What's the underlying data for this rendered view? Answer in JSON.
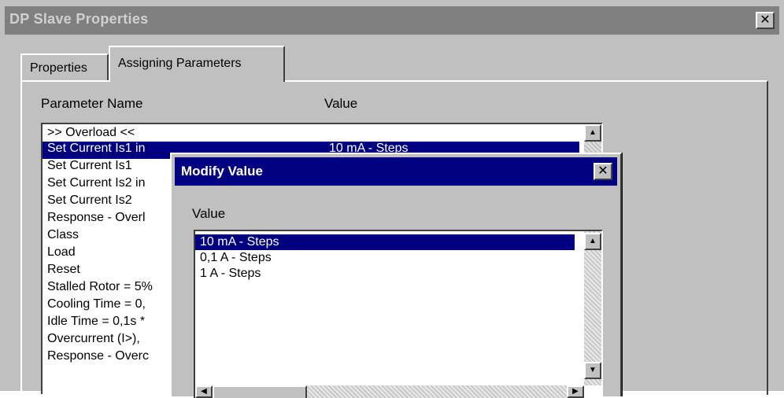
{
  "window": {
    "title": "DP Slave Properties"
  },
  "tabs": [
    {
      "label": "Properties"
    },
    {
      "label": "Assigning Parameters"
    }
  ],
  "columns": {
    "name": "Parameter Name",
    "value": "Value"
  },
  "parameters": [
    {
      "name": ">> Overload <<",
      "value": ""
    },
    {
      "name": "Set Current Is1 in",
      "value": "10 mA - Steps"
    },
    {
      "name": "Set Current Is1",
      "value": ""
    },
    {
      "name": "Set Current Is2 in",
      "value": ""
    },
    {
      "name": "Set Current Is2",
      "value": ""
    },
    {
      "name": "Response - Overl",
      "value": ""
    },
    {
      "name": "Class",
      "value": ""
    },
    {
      "name": "Load",
      "value": ""
    },
    {
      "name": "Reset",
      "value": ""
    },
    {
      "name": "Stalled Rotor = 5%",
      "value": ""
    },
    {
      "name": "Cooling Time = 0,",
      "value": ""
    },
    {
      "name": "Idle Time = 0,1s *",
      "value": ""
    },
    {
      "name": "Overcurrent (I>),",
      "value": ""
    },
    {
      "name": "Response - Overc",
      "value": ""
    }
  ],
  "dialog": {
    "title": "Modify Value",
    "label": "Value",
    "options": [
      "10 mA - Steps",
      "0,1 A - Steps",
      "1 A - Steps"
    ],
    "selected_index": 0
  },
  "colors": {
    "selection": "#000080",
    "face": "#c0c0c0",
    "inactive_title": "#808080"
  }
}
